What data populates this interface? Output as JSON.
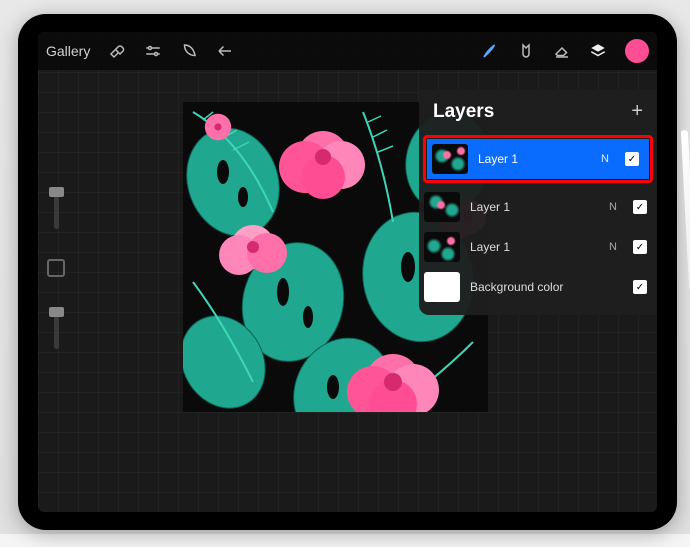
{
  "topbar": {
    "gallery_label": "Gallery"
  },
  "layers_panel": {
    "title": "Layers",
    "items": [
      {
        "label": "Layer 1",
        "blend": "N",
        "checked": true,
        "selected": true
      },
      {
        "label": "Layer 1",
        "blend": "N",
        "checked": true,
        "selected": false
      },
      {
        "label": "Layer 1",
        "blend": "N",
        "checked": true,
        "selected": false
      },
      {
        "label": "Background color",
        "blend": "",
        "checked": true,
        "selected": false
      }
    ]
  },
  "colors": {
    "accent": "#ff4d94",
    "selection": "#0a6cff",
    "highlight_frame": "#ff0000"
  }
}
